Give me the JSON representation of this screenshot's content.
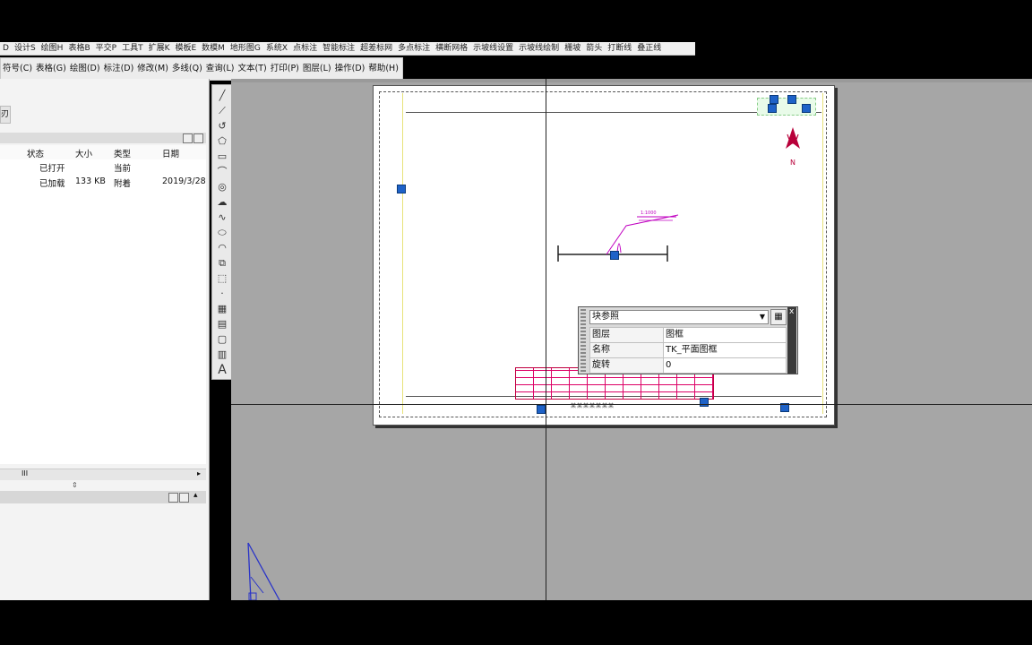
{
  "menubar_top": [
    "D",
    "设计S",
    "绘图H",
    "表格B",
    "平交P",
    "工具T",
    "扩展K",
    "模板E",
    "数模M",
    "地形图G",
    "系统X",
    "点标注",
    "智能标注",
    "超差标网",
    "多点标注",
    "横断网格",
    "示坡线设置",
    "示坡线绘制",
    "栅坡",
    "箭头",
    "打断线",
    "叠正线"
  ],
  "menubar_main": [
    "符号(C)",
    "表格(G)",
    "绘图(D)",
    "标注(D)",
    "修改(M)",
    "多线(Q)",
    "查询(L)",
    "文本(T)",
    "打印(P)",
    "图层(L)",
    "操作(D)",
    "帮助(H)"
  ],
  "left_panel": {
    "toolbar_glyph": "刃",
    "columns": [
      "状态",
      "大小",
      "类型",
      "日期"
    ],
    "rows": [
      {
        "status": "已打开",
        "size": "",
        "type": "当前",
        "date": ""
      },
      {
        "status": "已加载",
        "size": "133 KB",
        "type": "附着",
        "date": "2019/3/28"
      }
    ],
    "scroll_grip": "III"
  },
  "drawing": {
    "north_label": "N",
    "note_label": "1:1000",
    "title_text": "某某某某某某某"
  },
  "properties": {
    "dropdown_value": "块参照",
    "rows": [
      {
        "key": "图层",
        "value": "图框"
      },
      {
        "key": "名称",
        "value": "TK_平面图框"
      },
      {
        "key": "旋转",
        "value": "0"
      }
    ],
    "close_glyph": "x"
  },
  "toolbar_icons": [
    "line-icon",
    "polyline-icon",
    "arc-icon",
    "polygon-icon",
    "rectangle-icon",
    "arc-tool-icon",
    "circle-icon",
    "cloud-icon",
    "spline-icon",
    "ellipse-icon",
    "ellipse-arc-icon",
    "insert-block-icon",
    "make-block-icon",
    "point-icon",
    "hatch-icon",
    "gradient-icon",
    "region-icon",
    "table-icon",
    "text-icon"
  ],
  "text_tool_glyph": "A",
  "colors": {
    "canvas": "#a6a6a6",
    "grip": "#1e62c8",
    "accent_red": "#c00040",
    "accent_magenta": "#c000c0"
  }
}
